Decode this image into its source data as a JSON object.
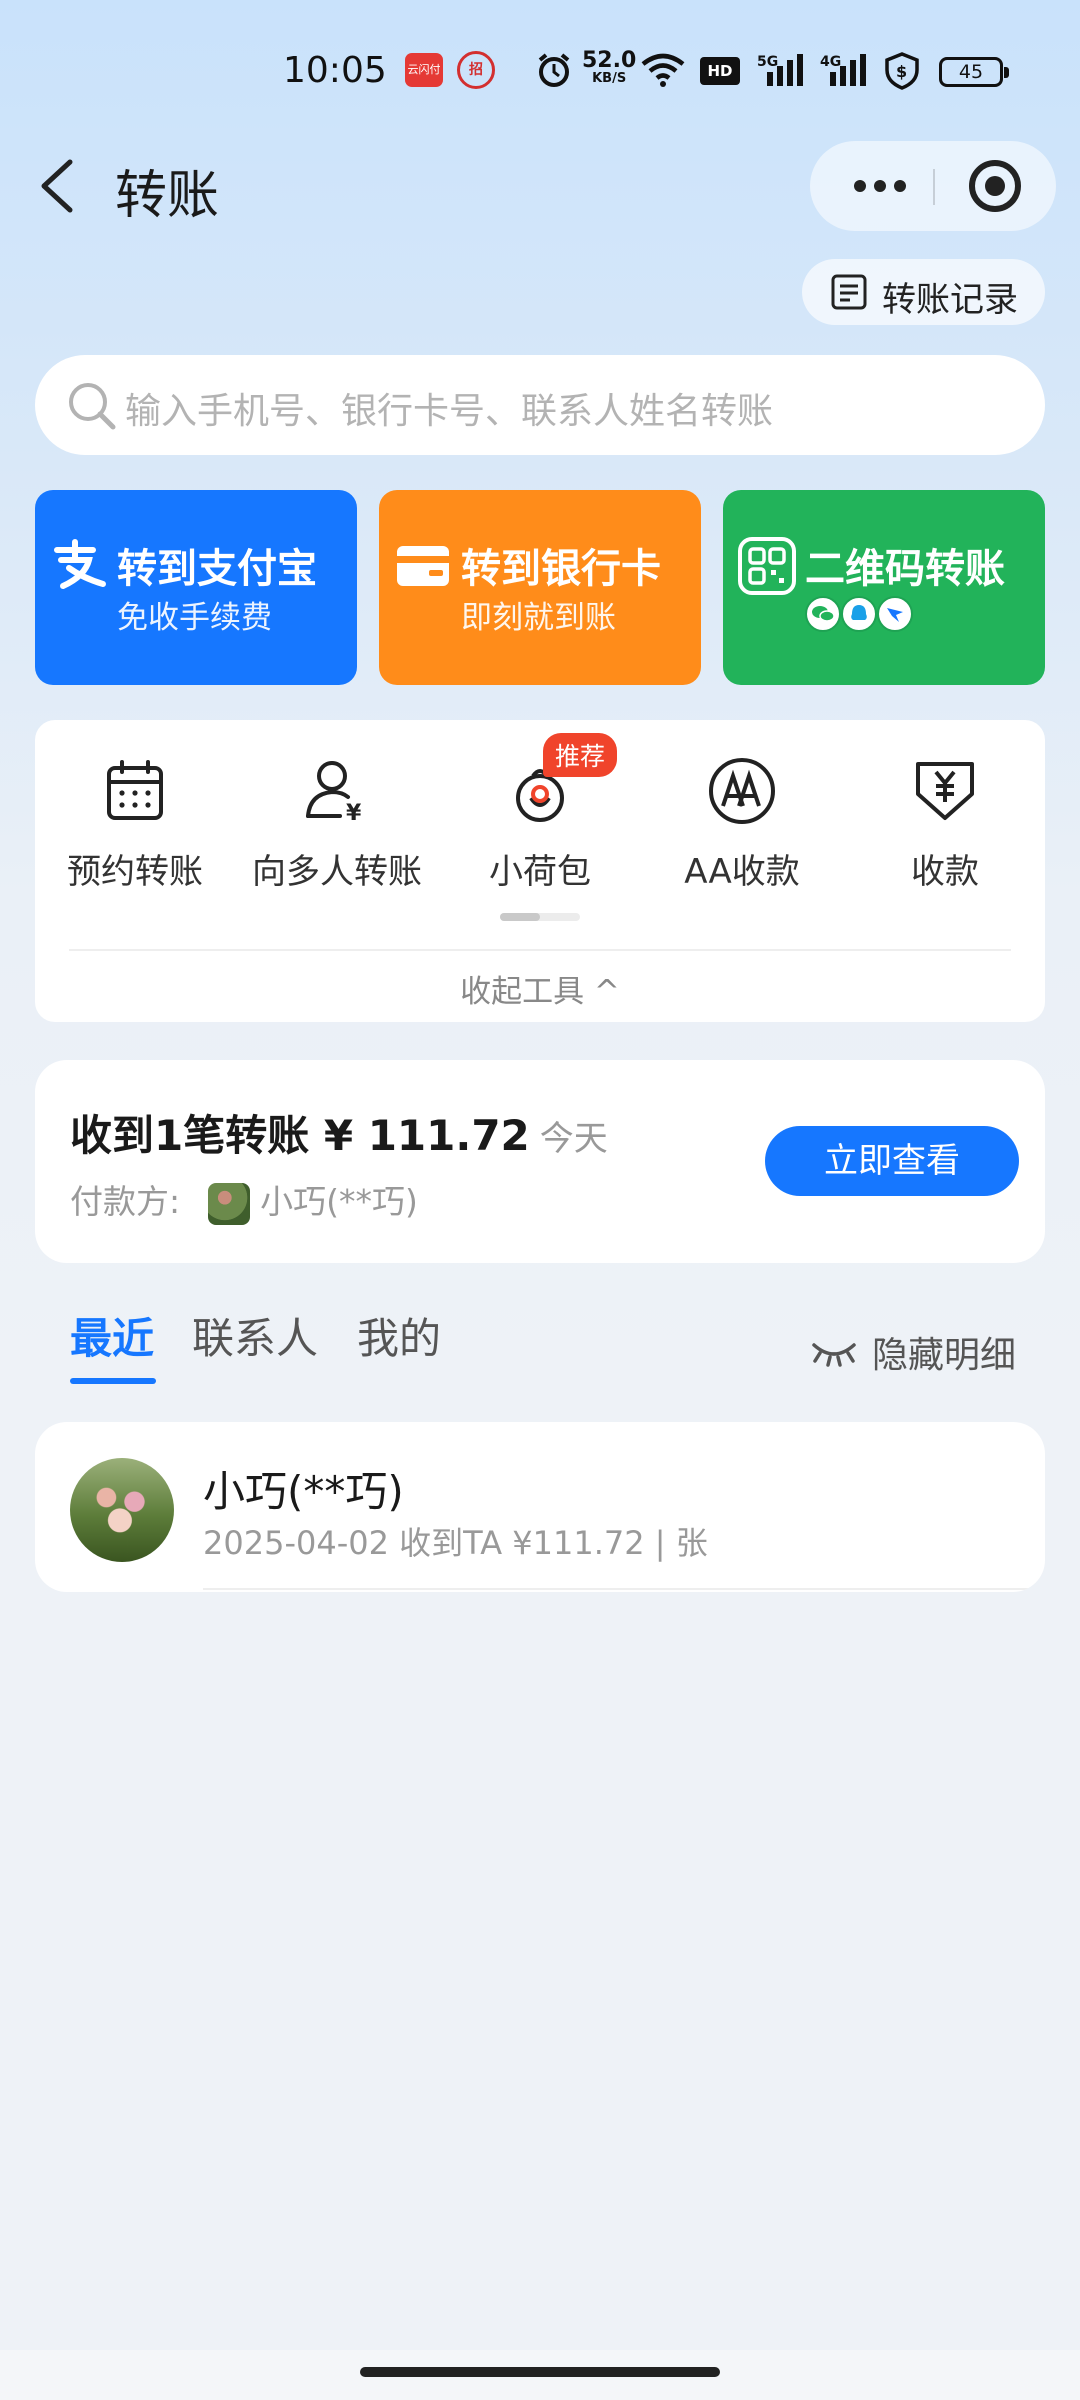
{
  "status_bar": {
    "time": "10:05",
    "app1": "云闪付",
    "app2": "招",
    "net_speed": "52.0",
    "net_unit": "KB/S",
    "hd_label": "HD",
    "sig1_label": "5G",
    "sig2_label": "4G",
    "battery": "45"
  },
  "header": {
    "title": "转账",
    "record_label": "转账记录"
  },
  "search": {
    "placeholder": "输入手机号、银行卡号、联系人姓名转账"
  },
  "big_actions": [
    {
      "title": "转到支付宝",
      "subtitle": "免收手续费",
      "color": "#1677ff"
    },
    {
      "title": "转到银行卡",
      "subtitle": "即刻就到账",
      "color": "#ff8c1a"
    },
    {
      "title": "二维码转账",
      "subtitle": "",
      "color": "#22b35a"
    }
  ],
  "tools": {
    "items": [
      {
        "label": "预约转账",
        "icon": "calendar-icon"
      },
      {
        "label": "向多人转账",
        "icon": "multi-user-yuan-icon"
      },
      {
        "label": "小荷包",
        "icon": "purse-icon"
      },
      {
        "label": "AA收款",
        "icon": "aa-icon"
      },
      {
        "label": "收款",
        "icon": "receive-yuan-icon"
      }
    ],
    "badge": "推荐",
    "collapse_label": "收起工具 ^"
  },
  "notice": {
    "title": "收到1笔转账 ¥ 111.72",
    "date": "今天",
    "payer_label": "付款方:",
    "payer_name": "小巧(**巧)",
    "button": "立即查看"
  },
  "tabs": {
    "items": [
      "最近",
      "联系人",
      "我的"
    ],
    "active": "最近",
    "hide_label": "隐藏明细"
  },
  "recent": [
    {
      "name": "小巧(**巧)",
      "meta": "2025-04-02 收到TA ¥111.72 | 张"
    }
  ],
  "colors": {
    "accent": "#1677ff",
    "orange": "#ff8c1a",
    "green": "#22b35a",
    "badge": "#f0442b"
  }
}
